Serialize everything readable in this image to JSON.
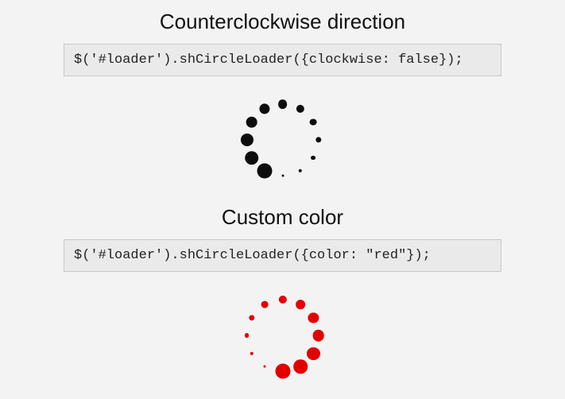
{
  "sections": [
    {
      "title": "Counterclockwise direction",
      "code": "$('#loader').shCircleLoader({clockwise: false});",
      "loader": {
        "color": "#0d0d0d",
        "radius": 45,
        "dotCount": 12,
        "minDot": 3,
        "maxDot": 19,
        "startAngle": 90,
        "growDirection": "ccw"
      }
    },
    {
      "title": "Custom color",
      "code": "$('#loader').shCircleLoader({color: \"red\"});",
      "loader": {
        "color": "#e40000",
        "radius": 45,
        "dotCount": 12,
        "minDot": 3,
        "maxDot": 19,
        "startAngle": 120,
        "growDirection": "cw"
      }
    }
  ]
}
